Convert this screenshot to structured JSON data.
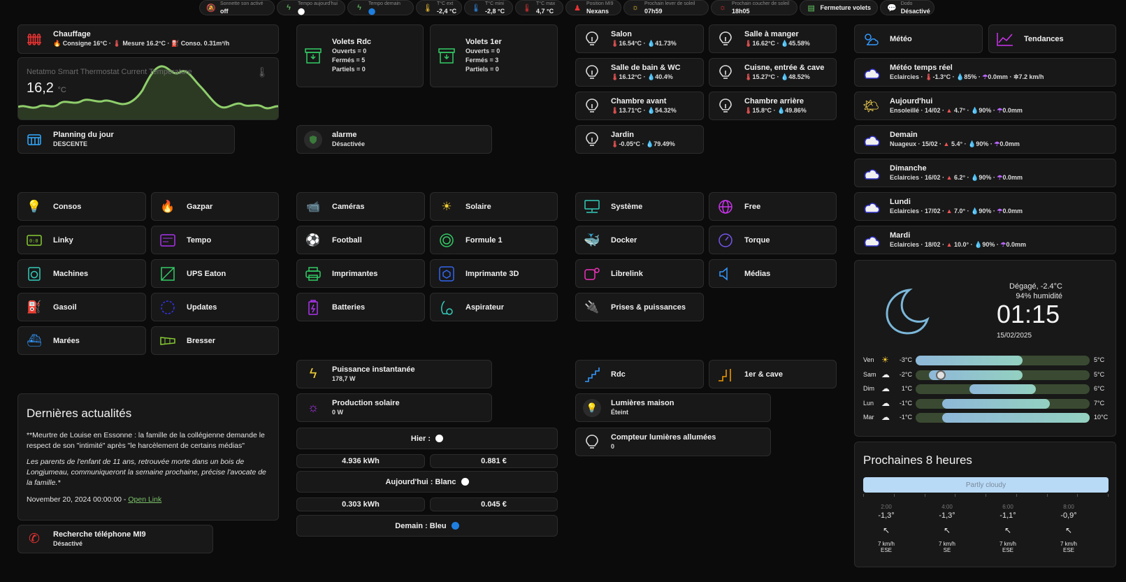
{
  "chips": [
    {
      "sub": "Sonnette son activé",
      "val": "off",
      "icon": "bell-off-icon"
    },
    {
      "sub": "Tempo aujourd'hui",
      "val": "⬤",
      "icon": "flash-icon"
    },
    {
      "sub": "Tempo demain",
      "val": "⬤",
      "icon": "flash-icon"
    },
    {
      "sub": "T°C ext",
      "val": "-2,4 °C",
      "icon": "thermometer-icon"
    },
    {
      "sub": "T°C mini",
      "val": "-2,8 °C",
      "icon": "thermometer-low-icon"
    },
    {
      "sub": "T°C max",
      "val": "4,7 °C",
      "icon": "thermometer-high-icon"
    },
    {
      "sub": "Position MI9",
      "val": "Nexans",
      "icon": "person-icon"
    },
    {
      "sub": "Prochain lever de soleil",
      "val": "07h59",
      "icon": "sunrise-icon"
    },
    {
      "sub": "Prochain coucher de soleil",
      "val": "18h05",
      "icon": "sunset-icon"
    },
    {
      "sub": "",
      "val": "Fermeture volets",
      "icon": "shutter-icon"
    },
    {
      "sub": "Dodo",
      "val": "Désactivé",
      "icon": "sleep-icon"
    }
  ],
  "chauffage": {
    "title": "Chauffage",
    "consigne": "Consigne 16°C",
    "mesure": "Mesure 16.2°C",
    "conso": "Conso. 0.31m³/h"
  },
  "thermostat": {
    "title": "Netatmo Smart Thermostat Current Temperature",
    "value": "16,2",
    "unit": "°C"
  },
  "planning": {
    "title": "Planning du jour",
    "sub": "DESCENTE"
  },
  "volets": [
    {
      "title": "Volets Rdc",
      "l1": "Ouverts = 0",
      "l2": "Fermés = 5",
      "l3": "Partiels = 0"
    },
    {
      "title": "Volets 1er",
      "l1": "Ouverts = 0",
      "l2": "Fermés = 3",
      "l3": "Partiels = 0"
    }
  ],
  "alarme": {
    "title": "alarme",
    "sub": "Désactivée"
  },
  "rooms": [
    {
      "name": "Salon",
      "temp": "16.54°C",
      "hum": "41.73%"
    },
    {
      "name": "Salle à manger",
      "temp": "16.62°C",
      "hum": "45.58%"
    },
    {
      "name": "Salle de bain & WC",
      "temp": "16.12°C",
      "hum": "40.4%"
    },
    {
      "name": "Cuisne, entrée & cave",
      "temp": "15.27°C",
      "hum": "48.52%"
    },
    {
      "name": "Chambre avant",
      "temp": "13.71°C",
      "hum": "54.32%"
    },
    {
      "name": "Chambre arrière",
      "temp": "15.8°C",
      "hum": "49.86%"
    },
    {
      "name": "Jardin",
      "temp": "-0.05°C",
      "hum": "79.49%"
    }
  ],
  "nav": {
    "meteo": "Météo",
    "tendances": "Tendances"
  },
  "forecast": [
    {
      "title": "Météo temps réel",
      "cond": "Eclaircies",
      "temp": "-1.3°C",
      "hum": "85%",
      "rain": "0.0mm",
      "wind": "7.2 km/h"
    },
    {
      "title": "Aujourd'hui",
      "cond": "Ensoleillé · 14/02",
      "temp": "4.7°",
      "hum": "90%",
      "rain": "0.0mm"
    },
    {
      "title": "Demain",
      "cond": "Nuageux · 15/02",
      "temp": "5.4°",
      "hum": "90%",
      "rain": "0.0mm"
    },
    {
      "title": "Dimanche",
      "cond": "Eclaircies · 16/02",
      "temp": "6.2°",
      "hum": "90%",
      "rain": "0.0mm"
    },
    {
      "title": "Lundi",
      "cond": "Eclaircies · 17/02",
      "temp": "7.0°",
      "hum": "90%",
      "rain": "0.0mm"
    },
    {
      "title": "Mardi",
      "cond": "Eclaircies · 18/02",
      "temp": "10.0°",
      "hum": "90%",
      "rain": "0.0mm"
    }
  ],
  "groups": {
    "g1": [
      "Consos",
      "Gazpar",
      "Linky",
      "Tempo",
      "Machines",
      "UPS Eaton",
      "Gasoil",
      "Updates",
      "Marées",
      "Bresser"
    ],
    "g2": [
      "Caméras",
      "Solaire",
      "Football",
      "Formule 1",
      "Imprimantes",
      "Imprimante 3D",
      "Batteries",
      "Aspirateur"
    ],
    "g3": [
      "Système",
      "Free",
      "Docker",
      "Torque",
      "Librelink",
      "Médias",
      "Prises & puissances"
    ]
  },
  "clock": {
    "cond": "Dégagé, -2.4°C",
    "hum": "94% humidité",
    "time": "01:15",
    "date": "15/02/2025"
  },
  "week": [
    {
      "day": "Ven",
      "low": "-3°C",
      "high": "5°C",
      "min": -3,
      "max": 5
    },
    {
      "day": "Sam",
      "low": "-2°C",
      "high": "5°C",
      "min": -2,
      "max": 5
    },
    {
      "day": "Dim",
      "low": "1°C",
      "high": "6°C",
      "min": 1,
      "max": 6
    },
    {
      "day": "Lun",
      "low": "-1°C",
      "high": "7°C",
      "min": -1,
      "max": 7
    },
    {
      "day": "Mar",
      "low": "-1°C",
      "high": "10°C",
      "min": -1,
      "max": 10
    }
  ],
  "news": {
    "title": "Dernières actualités",
    "p1": "**Meurtre de Louise en Essonne : la famille de la collégienne demande le respect de son \"intimité\" après \"le harcèlement de certains médias\"",
    "p2": "Les parents de l'enfant de 11 ans, retrouvée morte dans un bois de Longjumeau, communiqueront la semaine prochaine, précise l'avocate de la famille.*",
    "date": "November 20, 2024 00:00:00 - ",
    "link": "Open Link"
  },
  "phone": {
    "title": "Recherche téléphone MI9",
    "sub": "Désactivé"
  },
  "power": {
    "title": "Puissance instantanée",
    "val": "178,7 W"
  },
  "solar": {
    "title": "Production solaire",
    "val": "0 W"
  },
  "tempo": {
    "hier": "Hier :",
    "hier_kwh": "4.936 kWh",
    "hier_eur": "0.881 €",
    "auj": "Aujourd'hui : Blanc",
    "auj_kwh": "0.303 kWh",
    "auj_eur": "0.045 €",
    "dem": "Demain : Bleu"
  },
  "lights": {
    "rdc": "Rdc",
    "first": "1er & cave",
    "maison": "Lumières maison",
    "maison_sub": "Éteint",
    "compteur": "Compteur lumières allumées",
    "compteur_val": "0"
  },
  "hourly": {
    "title": "Prochaines 8 heures",
    "cond": "Partly cloudy",
    "hours": [
      {
        "t": "2:00",
        "temp": "-1,3°",
        "wind": "7 km/h",
        "dir": "ESE"
      },
      {
        "t": "4:00",
        "temp": "-1,3°",
        "wind": "7 km/h",
        "dir": "SE"
      },
      {
        "t": "6:00",
        "temp": "-1,1°",
        "wind": "7 km/h",
        "dir": "ESE"
      },
      {
        "t": "8:00",
        "temp": "-0,9°",
        "wind": "7 km/h",
        "dir": "ESE"
      }
    ]
  }
}
